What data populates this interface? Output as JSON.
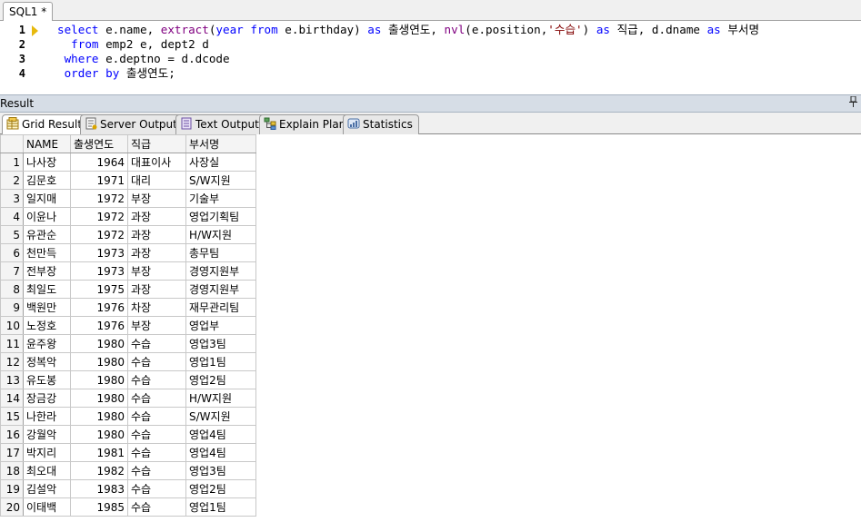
{
  "doc_tab": {
    "label": "SQL1 *"
  },
  "editor": {
    "line_numbers": [
      "1",
      "2",
      "3",
      "4"
    ],
    "lines": [
      [
        {
          "t": "select",
          "c": "kw"
        },
        {
          "t": " e.name, ",
          "c": ""
        },
        {
          "t": "extract",
          "c": "fn"
        },
        {
          "t": "(",
          "c": ""
        },
        {
          "t": "year",
          "c": "kw"
        },
        {
          "t": " ",
          "c": ""
        },
        {
          "t": "from",
          "c": "kw"
        },
        {
          "t": " e.birthday) ",
          "c": ""
        },
        {
          "t": "as",
          "c": "kw"
        },
        {
          "t": " 출생연도, ",
          "c": ""
        },
        {
          "t": "nvl",
          "c": "fn"
        },
        {
          "t": "(e.position,",
          "c": ""
        },
        {
          "t": "'수습'",
          "c": "str"
        },
        {
          "t": ") ",
          "c": ""
        },
        {
          "t": "as",
          "c": "kw"
        },
        {
          "t": " 직급, d.dname ",
          "c": ""
        },
        {
          "t": "as",
          "c": "kw"
        },
        {
          "t": " 부서명",
          "c": ""
        }
      ],
      [
        {
          "t": "  ",
          "c": ""
        },
        {
          "t": "from",
          "c": "kw"
        },
        {
          "t": " emp2 e, dept2 d",
          "c": ""
        }
      ],
      [
        {
          "t": " ",
          "c": ""
        },
        {
          "t": "where",
          "c": "kw"
        },
        {
          "t": " e.deptno = d.dcode",
          "c": ""
        }
      ],
      [
        {
          "t": " ",
          "c": ""
        },
        {
          "t": "order",
          "c": "kw"
        },
        {
          "t": " ",
          "c": ""
        },
        {
          "t": "by",
          "c": "kw"
        },
        {
          "t": " 출생연도;",
          "c": ""
        }
      ]
    ]
  },
  "result_panel": {
    "title": "Result",
    "pin_icon": "pin-icon"
  },
  "result_tabs": [
    {
      "label": "Grid Result",
      "icon": "grid-icon",
      "active": true
    },
    {
      "label": "Server Output",
      "icon": "server-output-icon",
      "active": false
    },
    {
      "label": "Text Output",
      "icon": "text-output-icon",
      "active": false
    },
    {
      "label": "Explain Plan",
      "icon": "explain-plan-icon",
      "active": false
    },
    {
      "label": "Statistics",
      "icon": "statistics-icon",
      "active": false
    }
  ],
  "grid": {
    "columns": [
      "NAME",
      "출생연도",
      "직급",
      "부서명"
    ],
    "rows": [
      [
        "1",
        "나사장",
        "1964",
        "대표이사",
        "사장실"
      ],
      [
        "2",
        "김문호",
        "1971",
        "대리",
        "S/W지원"
      ],
      [
        "3",
        "일지매",
        "1972",
        "부장",
        "기술부"
      ],
      [
        "4",
        "이윤나",
        "1972",
        "과장",
        "영업기획팀"
      ],
      [
        "5",
        "유관순",
        "1972",
        "과장",
        "H/W지원"
      ],
      [
        "6",
        "천만득",
        "1973",
        "과장",
        "총무팀"
      ],
      [
        "7",
        "전부장",
        "1973",
        "부장",
        "경영지원부"
      ],
      [
        "8",
        "최일도",
        "1975",
        "과장",
        "경영지원부"
      ],
      [
        "9",
        "백원만",
        "1976",
        "차장",
        "재무관리팀"
      ],
      [
        "10",
        "노정호",
        "1976",
        "부장",
        "영업부"
      ],
      [
        "11",
        "윤주왕",
        "1980",
        "수습",
        "영업3팀"
      ],
      [
        "12",
        "정복악",
        "1980",
        "수습",
        "영업1팀"
      ],
      [
        "13",
        "유도봉",
        "1980",
        "수습",
        "영업2팀"
      ],
      [
        "14",
        "장금강",
        "1980",
        "수습",
        "H/W지원"
      ],
      [
        "15",
        "나한라",
        "1980",
        "수습",
        "S/W지원"
      ],
      [
        "16",
        "강월악",
        "1980",
        "수습",
        "영업4팀"
      ],
      [
        "17",
        "박지리",
        "1981",
        "수습",
        "영업4팀"
      ],
      [
        "18",
        "최오대",
        "1982",
        "수습",
        "영업3팀"
      ],
      [
        "19",
        "김설악",
        "1983",
        "수습",
        "영업2팀"
      ],
      [
        "20",
        "이태백",
        "1985",
        "수습",
        "영업1팀"
      ]
    ]
  }
}
